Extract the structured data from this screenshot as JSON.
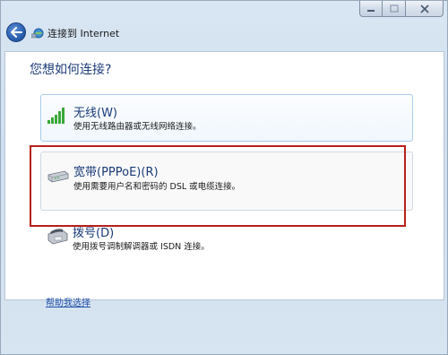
{
  "window": {
    "title": "连接到 Internet"
  },
  "page": {
    "question": "您想如何连接?"
  },
  "options": [
    {
      "title": "无线(W)",
      "description": "使用无线路由器或无线网络连接。",
      "icon": "wifi-signal-icon"
    },
    {
      "title": "宽带(PPPoE)(R)",
      "description": "使用需要用户名和密码的 DSL 或电缆连接。",
      "icon": "broadband-modem-icon"
    },
    {
      "title": "拨号(D)",
      "description": "使用拨号调制解调器或 ISDN 连接。",
      "icon": "dialup-modem-icon"
    }
  ],
  "help": {
    "link_label": "帮助我选择"
  },
  "colors": {
    "highlight_border": "#b8201a",
    "title_text": "#1a3a78",
    "link": "#1f4fa8"
  }
}
